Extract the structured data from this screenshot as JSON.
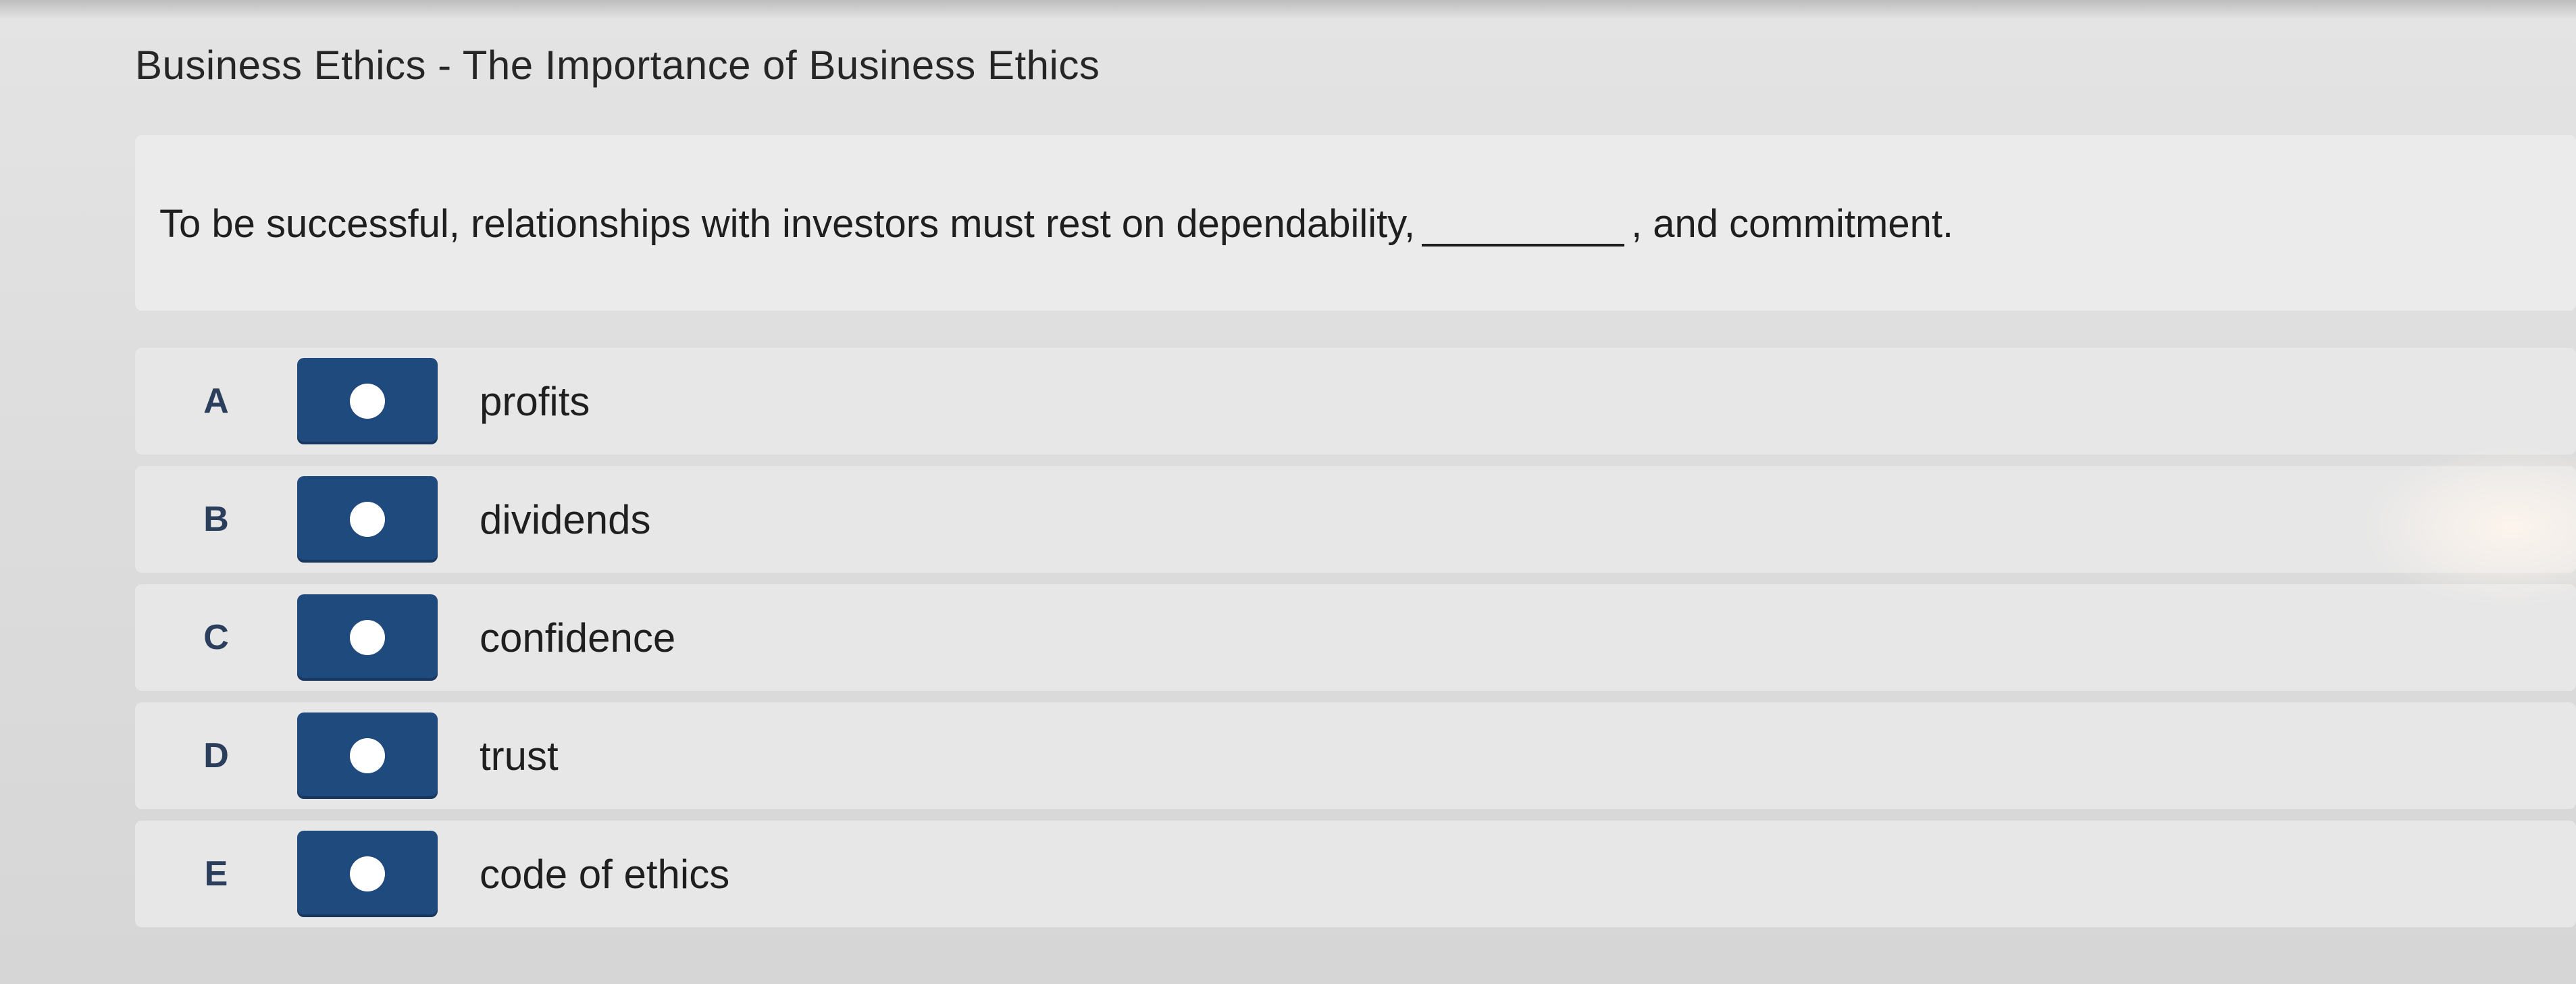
{
  "page": {
    "title": "Business Ethics - The Importance of Business Ethics"
  },
  "question": {
    "text_before": "To be successful, relationships with investors must rest on dependability,",
    "text_after": ", and commitment."
  },
  "options": [
    {
      "letter": "A",
      "label": "profits"
    },
    {
      "letter": "B",
      "label": "dividends"
    },
    {
      "letter": "C",
      "label": "confidence"
    },
    {
      "letter": "D",
      "label": "trust"
    },
    {
      "letter": "E",
      "label": "code of ethics"
    }
  ],
  "colors": {
    "radio_button": "#1f4a7e",
    "letter": "#2b3f5c",
    "background": "#dddddd"
  }
}
